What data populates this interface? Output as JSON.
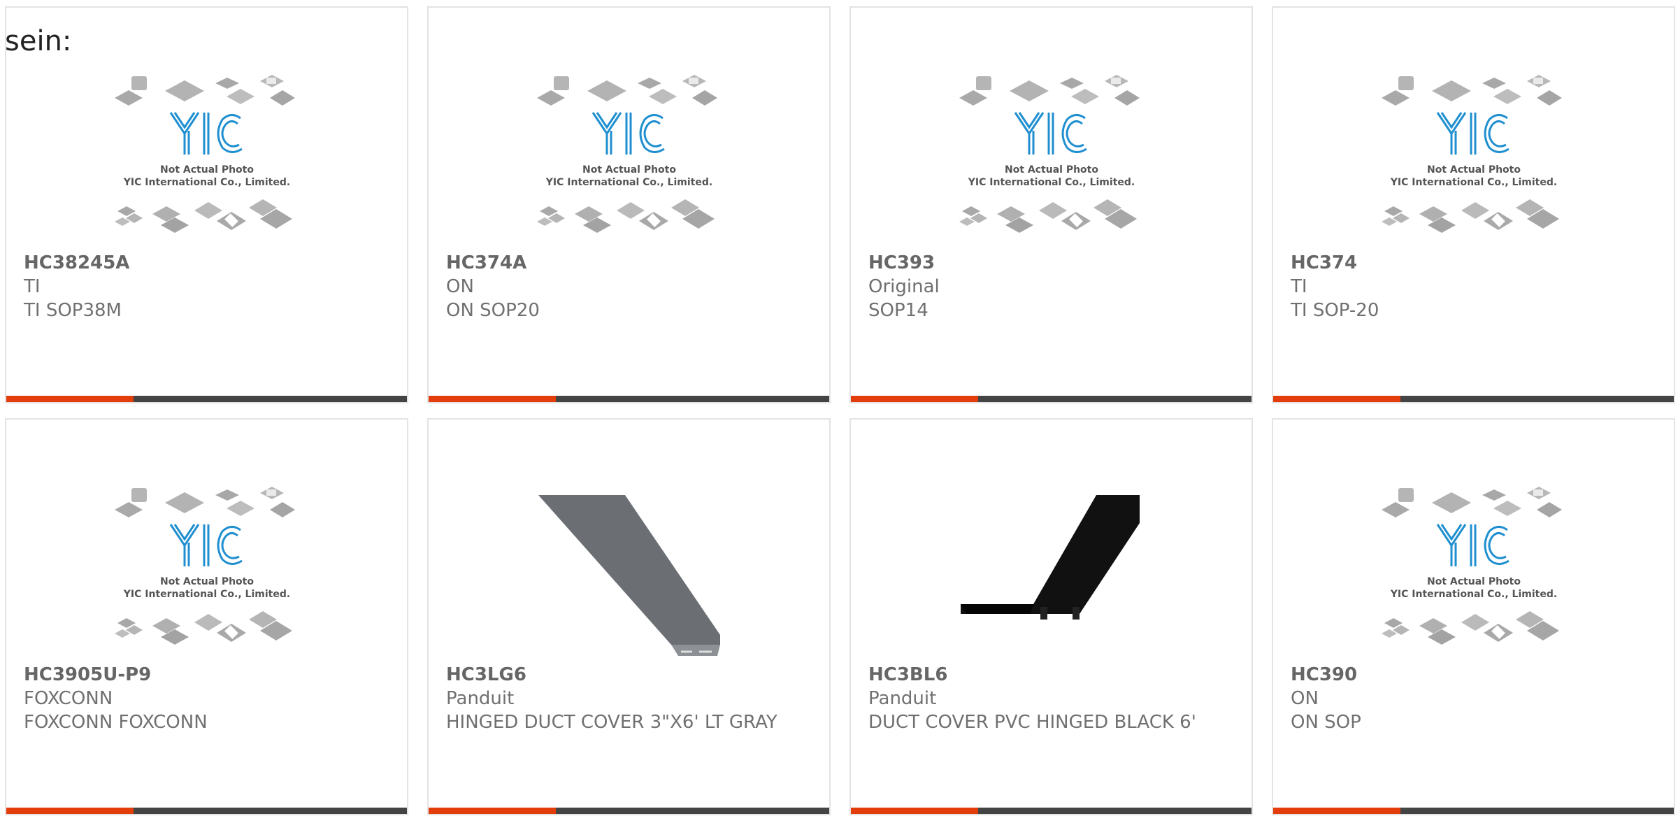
{
  "intro_text": "sein:",
  "placeholder": {
    "line1": "Not Actual Photo",
    "line2": "YIC International Co., Limited."
  },
  "colors": {
    "accent": "#e23d0b",
    "bar": "#444444",
    "logo": "#1f8fd0",
    "border": "#e3e3e3"
  },
  "products": [
    {
      "part": "HC38245A",
      "brand": "TI",
      "desc": "TI SOP38M",
      "image": "placeholder"
    },
    {
      "part": "HC374A",
      "brand": "ON",
      "desc": "ON SOP20",
      "image": "placeholder"
    },
    {
      "part": "HC393",
      "brand": "Original",
      "desc": "SOP14",
      "image": "placeholder"
    },
    {
      "part": "HC374",
      "brand": "TI",
      "desc": "TI SOP-20",
      "image": "placeholder"
    },
    {
      "part": "HC3905U-P9",
      "brand": "FOXCONN",
      "desc": "FOXCONN FOXCONN",
      "image": "placeholder"
    },
    {
      "part": "HC3LG6",
      "brand": "Panduit",
      "desc": "HINGED DUCT COVER 3\"X6' LT GRAY",
      "image": "duct-cover-gray"
    },
    {
      "part": "HC3BL6",
      "brand": "Panduit",
      "desc": "DUCT COVER PVC HINGED BLACK 6'",
      "image": "duct-cover-black"
    },
    {
      "part": "HC390",
      "brand": "ON",
      "desc": "ON SOP",
      "image": "placeholder"
    }
  ]
}
